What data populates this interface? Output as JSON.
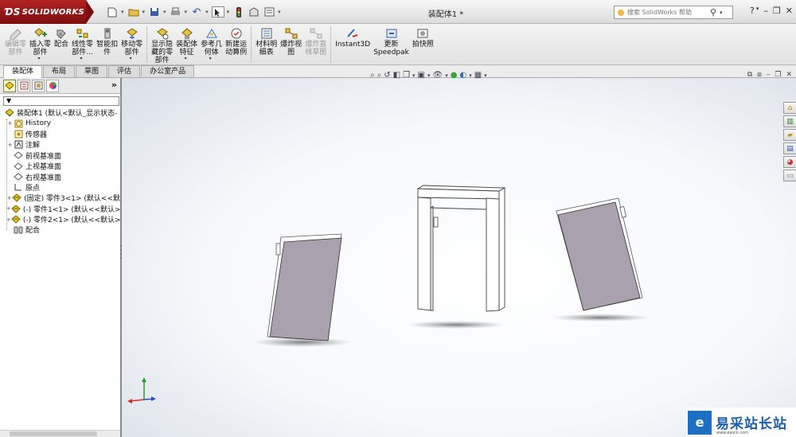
{
  "app": {
    "logo_text": "SOLIDWORKS",
    "doc_title": "装配体1 *"
  },
  "search": {
    "placeholder": "搜索 SolidWorks 帮助"
  },
  "ribbon": {
    "buttons": [
      {
        "label": "编辑零\n部件",
        "disabled": true
      },
      {
        "label": "插入零\n部件",
        "dropdown": true
      },
      {
        "label": "配合"
      },
      {
        "label": "线性零\n部件...",
        "dropdown": true
      },
      {
        "label": "智能扣\n件"
      },
      {
        "label": "移动零\n部件",
        "dropdown": true
      },
      {
        "label": "显示隐\n藏的零\n部件"
      },
      {
        "label": "装配体\n特征",
        "dropdown": true
      },
      {
        "label": "参考几\n何体",
        "dropdown": true
      },
      {
        "label": "新建运\n动算例"
      },
      {
        "label": "材料明\n细表"
      },
      {
        "label": "爆炸视\n图"
      },
      {
        "label": "爆炸直\n线草图",
        "disabled": true
      },
      {
        "label": "Instant3D"
      },
      {
        "label": "更新\nSpeedpak"
      },
      {
        "label": "拍快照"
      }
    ]
  },
  "tabs": [
    "装配体",
    "布局",
    "草图",
    "评估",
    "办公室产品"
  ],
  "feature_tree": {
    "filter": "▼",
    "more": "»",
    "nodes": [
      {
        "label": "装配体1 (默认<默认_显示状态-",
        "icon": "assembly-icon",
        "expand": ""
      },
      {
        "label": "History",
        "icon": "history-icon",
        "expand": "+"
      },
      {
        "label": "传感器",
        "icon": "sensor-icon",
        "expand": ""
      },
      {
        "label": "注解",
        "icon": "annotation-icon",
        "expand": "+"
      },
      {
        "label": "前视基准面",
        "icon": "plane-icon",
        "expand": ""
      },
      {
        "label": "上视基准面",
        "icon": "plane-icon",
        "expand": ""
      },
      {
        "label": "右视基准面",
        "icon": "plane-icon",
        "expand": ""
      },
      {
        "label": "原点",
        "icon": "origin-icon",
        "expand": ""
      },
      {
        "label": "(固定) 零件3<1> (默认<<默",
        "icon": "part-icon",
        "expand": "+"
      },
      {
        "label": "(-) 零件1<1> (默认<<默认>",
        "icon": "part-icon",
        "expand": "+"
      },
      {
        "label": "(-) 零件2<1> (默认<<默认>",
        "icon": "part-icon",
        "expand": "+"
      },
      {
        "label": "配合",
        "icon": "mates-icon",
        "expand": ""
      }
    ]
  },
  "watermark": {
    "text": "易采站长站",
    "logo": "e",
    "sub": "www.easck.com"
  },
  "colors": {
    "brand_red": "#9a1616",
    "part_face": "#a9a1ad",
    "part_edge": "#ffffff"
  }
}
